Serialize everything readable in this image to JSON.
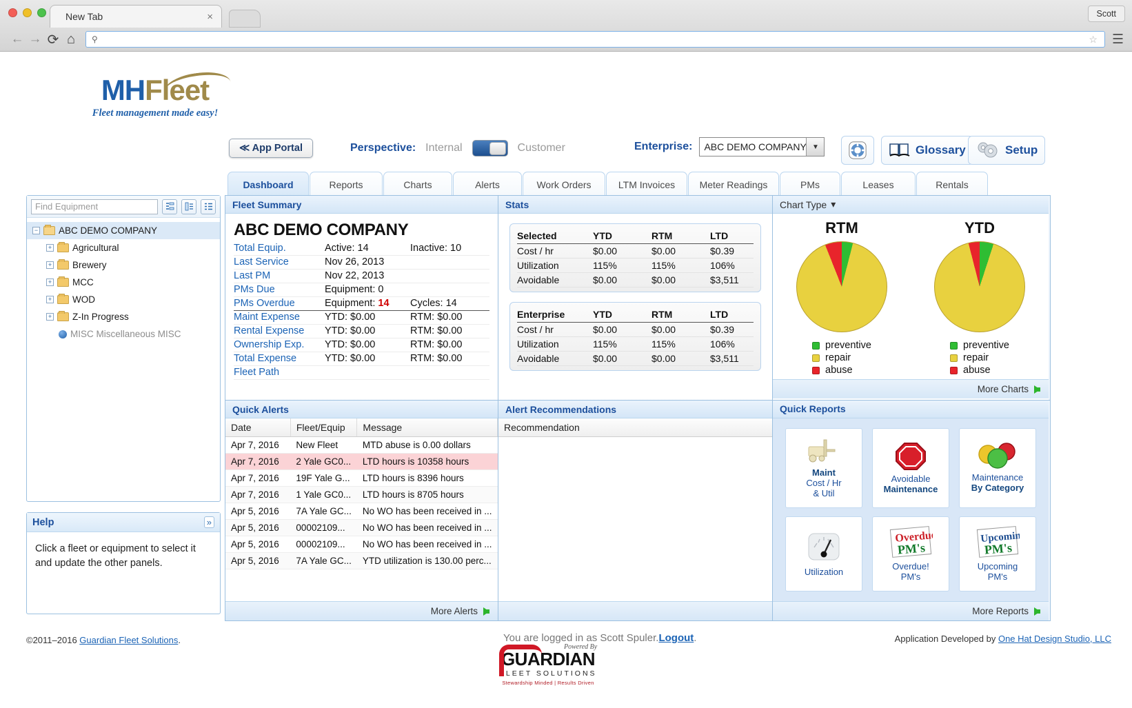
{
  "browser": {
    "tab_title": "New Tab",
    "close_label": "×",
    "profile_label": "Scott",
    "back_icon": "←",
    "forward_icon": "→",
    "reload_icon": "⟳",
    "home_icon": "⌂",
    "search_icon": "⚲",
    "star_icon": "☆",
    "menu_icon": "☰",
    "address_value": ""
  },
  "brand": {
    "logo_mh": "MH",
    "logo_fleet": "Fleet",
    "tagline": "Fleet management made easy!"
  },
  "header": {
    "app_portal": "≪ App Portal",
    "perspective_label": "Perspective:",
    "perspective_internal": "Internal",
    "perspective_customer": "Customer",
    "perspective_value": "Customer",
    "enterprise_label": "Enterprise:",
    "enterprise_value": "ABC DEMO COMPANY",
    "enterprise_options": [
      "ABC DEMO COMPANY"
    ],
    "glossary": "Glossary",
    "setup": "Setup",
    "dropdown_icon": "▼"
  },
  "tabs": [
    {
      "label": "Dashboard",
      "active": true
    },
    {
      "label": "Reports",
      "active": false
    },
    {
      "label": "Charts",
      "active": false
    },
    {
      "label": "Alerts",
      "active": false
    },
    {
      "label": "Work Orders",
      "active": false
    },
    {
      "label": "LTM Invoices",
      "active": false
    },
    {
      "label": "Meter Readings",
      "active": false
    },
    {
      "label": "PMs",
      "active": false
    },
    {
      "label": "Leases",
      "active": false
    },
    {
      "label": "Rentals",
      "active": false
    }
  ],
  "sidebar": {
    "search_placeholder": "Find Equipment",
    "search_value": "",
    "tree": [
      {
        "label": "ABC DEMO COMPANY",
        "level": 0,
        "expander": "−",
        "type": "folder-open",
        "selected": true
      },
      {
        "label": "Agricultural",
        "level": 1,
        "expander": "+",
        "type": "folder"
      },
      {
        "label": "Brewery",
        "level": 1,
        "expander": "+",
        "type": "folder"
      },
      {
        "label": "MCC",
        "level": 1,
        "expander": "+",
        "type": "folder"
      },
      {
        "label": "WOD",
        "level": 1,
        "expander": "+",
        "type": "folder"
      },
      {
        "label": "Z-In Progress",
        "level": 1,
        "expander": "+",
        "type": "folder"
      },
      {
        "label": "MISC Miscellaneous MISC",
        "level": 2,
        "expander": "",
        "type": "item"
      }
    ]
  },
  "help": {
    "title": "Help",
    "collapse_icon": "»",
    "text": "Click a fleet or equipment to select it and update the other panels."
  },
  "fleet_summary": {
    "panel_title": "Fleet Summary",
    "company": "ABC DEMO COMPANY",
    "rows": [
      {
        "key": "Total Equip.",
        "v1": "Active: 14",
        "v2": "Inactive: 10"
      },
      {
        "key": "Last Service",
        "v1": "Nov 26, 2013",
        "v2": ""
      },
      {
        "key": "Last PM",
        "v1": "Nov 22, 2013",
        "v2": ""
      },
      {
        "key": "PMs Due",
        "v1": "Equipment: 0",
        "v2": ""
      },
      {
        "key": "PMs Overdue",
        "v1": "Equipment: ",
        "v1_red": "14",
        "v2": "Cycles: 14"
      },
      {
        "key": "Maint Expense",
        "v1": "YTD: $0.00",
        "v2": "RTM: $0.00"
      },
      {
        "key": "Rental Expense",
        "v1": "YTD: $0.00",
        "v2": "RTM: $0.00"
      },
      {
        "key": "Ownership Exp.",
        "v1": "YTD: $0.00",
        "v2": "RTM: $0.00"
      },
      {
        "key": "Total Expense",
        "v1": "YTD: $0.00",
        "v2": "RTM: $0.00"
      },
      {
        "key": "Fleet Path",
        "v1": "",
        "v2": ""
      }
    ]
  },
  "stats": {
    "panel_title": "Stats",
    "tables": [
      {
        "header": [
          "Selected",
          "YTD",
          "RTM",
          "LTD"
        ],
        "rows": [
          [
            "Cost / hr",
            "$0.00",
            "$0.00",
            "$0.39"
          ],
          [
            "Utilization",
            "115%",
            "115%",
            "106%"
          ],
          [
            "Avoidable",
            "$0.00",
            "$0.00",
            "$3,511"
          ]
        ]
      },
      {
        "header": [
          "Enterprise",
          "YTD",
          "RTM",
          "LTD"
        ],
        "rows": [
          [
            "Cost / hr",
            "$0.00",
            "$0.00",
            "$0.39"
          ],
          [
            "Utilization",
            "115%",
            "115%",
            "106%"
          ],
          [
            "Avoidable",
            "$0.00",
            "$0.00",
            "$3,511"
          ]
        ]
      }
    ]
  },
  "charts_panel": {
    "chart_type_label": "Chart Type",
    "chart_type_caret": "▾",
    "more_charts": "More Charts"
  },
  "chart_data": [
    {
      "type": "pie",
      "title": "RTM",
      "categories": [
        "preventive",
        "repair",
        "abuse"
      ],
      "values": [
        4,
        90,
        6
      ],
      "colors": [
        "#2fbd33",
        "#e8d13f",
        "#e8242b"
      ],
      "legend": [
        "preventive",
        "repair",
        "abuse"
      ],
      "legend_position": "bottom"
    },
    {
      "type": "pie",
      "title": "YTD",
      "categories": [
        "preventive",
        "repair",
        "abuse"
      ],
      "values": [
        5,
        91,
        4
      ],
      "colors": [
        "#2fbd33",
        "#e8d13f",
        "#e8242b"
      ],
      "legend": [
        "preventive",
        "repair",
        "abuse"
      ],
      "legend_position": "bottom"
    }
  ],
  "quick_alerts": {
    "panel_title": "Quick Alerts",
    "columns": [
      "Date",
      "Fleet/Equip",
      "Message"
    ],
    "rows": [
      {
        "date": "Apr 7, 2016",
        "equip": "New Fleet",
        "message": "MTD abuse is 0.00 dollars",
        "danger": false
      },
      {
        "date": "Apr 7, 2016",
        "equip": "2 Yale GC0...",
        "message": "LTD hours is 10358 hours",
        "danger": true
      },
      {
        "date": "Apr 7, 2016",
        "equip": "19F Yale G...",
        "message": "LTD hours is 8396 hours",
        "danger": false
      },
      {
        "date": "Apr 7, 2016",
        "equip": "1 Yale GC0...",
        "message": "LTD hours is 8705 hours",
        "danger": false
      },
      {
        "date": "Apr 5, 2016",
        "equip": "7A Yale GC...",
        "message": "No WO has been received in ...",
        "danger": false
      },
      {
        "date": "Apr 5, 2016",
        "equip": "00002109...",
        "message": "No WO has been received in ...",
        "danger": false
      },
      {
        "date": "Apr 5, 2016",
        "equip": "00002109...",
        "message": "No WO has been received in ...",
        "danger": false
      },
      {
        "date": "Apr 5, 2016",
        "equip": "7A Yale GC...",
        "message": "YTD utilization is 130.00 perc...",
        "danger": false
      }
    ],
    "more_alerts": "More Alerts"
  },
  "alert_recommendations": {
    "panel_title": "Alert Recommendations",
    "column": "Recommendation",
    "rows": []
  },
  "quick_reports": {
    "panel_title": "Quick Reports",
    "more_reports": "More Reports",
    "tiles": [
      {
        "icon": "forklift-icon",
        "line1": "Maint",
        "line2": "Cost / Hr",
        "line3": "& Util"
      },
      {
        "icon": "stop-sign-icon",
        "line1": "Avoidable",
        "line2": "Maintenance",
        "line3": ""
      },
      {
        "icon": "category-circles-icon",
        "line1": "Maintenance",
        "line2": "By Category",
        "line3": ""
      },
      {
        "icon": "gauge-icon",
        "line1": "Utilization",
        "line2": "",
        "line3": ""
      },
      {
        "icon": "overdue-pms-icon",
        "line1": "Overdue!",
        "line2": "PM's",
        "line3": ""
      },
      {
        "icon": "upcoming-pms-icon",
        "line1": "Upcoming",
        "line2": "PM's",
        "line3": ""
      }
    ]
  },
  "footer": {
    "copyright_prefix": "©2011–2016 ",
    "copyright_link": "Guardian Fleet Solutions",
    "copyright_suffix": ".",
    "logged_in_prefix": "You are logged in as Scott Spuler.",
    "logout": "Logout",
    "logged_in_suffix": ".",
    "developed_prefix": "Application Developed by ",
    "developed_link": "One Hat Design Studio, LLC",
    "guardian_powered": "Powered By",
    "guardian_name": "GUARDIAN",
    "guardian_sub": "FLEET SOLUTIONS",
    "guardian_tag": "Stewardship Minded | Results Driven"
  }
}
